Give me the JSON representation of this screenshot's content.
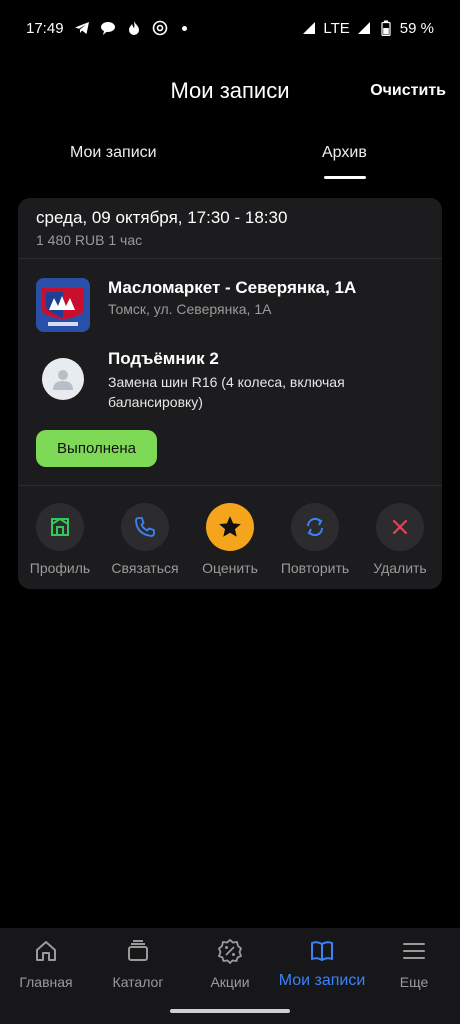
{
  "status_bar": {
    "time": "17:49",
    "network": "LTE",
    "battery": "59 %",
    "icons": [
      "telegram-icon",
      "chat-icon",
      "flame-icon",
      "sync-icon",
      "dot-icon",
      "signal-icon",
      "battery-icon"
    ]
  },
  "header": {
    "title": "Мои записи",
    "clear_label": "Очистить"
  },
  "tabs": [
    {
      "label": "Мои записи",
      "active": false
    },
    {
      "label": "Архив",
      "active": true
    }
  ],
  "booking": {
    "datetime": "среда, 09 октября, 17:30 - 18:30",
    "price_duration": "1 480 RUB 1 час",
    "company": {
      "name": "Масломаркет - Северянка, 1А",
      "address": "Томск, ул. Северянка, 1А"
    },
    "service": {
      "resource": "Подъёмник 2",
      "description": "Замена шин R16 (4 колеса, включая балансировку)"
    },
    "status": "Выполнена",
    "actions": [
      {
        "label": "Профиль",
        "icon": "store-icon",
        "color": "#34c759"
      },
      {
        "label": "Связаться",
        "icon": "phone-icon",
        "color": "#3b82f6"
      },
      {
        "label": "Оценить",
        "icon": "star-icon",
        "color": "#f5a51c"
      },
      {
        "label": "Повторить",
        "icon": "repeat-icon",
        "color": "#3b82f6"
      },
      {
        "label": "Удалить",
        "icon": "close-icon",
        "color": "#e83e5a"
      }
    ]
  },
  "bottom_nav": [
    {
      "label": "Главная",
      "icon": "home-icon",
      "active": false
    },
    {
      "label": "Каталог",
      "icon": "catalog-icon",
      "active": false
    },
    {
      "label": "Акции",
      "icon": "percent-icon",
      "active": false
    },
    {
      "label": "Мои записи",
      "icon": "book-icon",
      "active": true
    },
    {
      "label": "Еще",
      "icon": "menu-icon",
      "active": false
    }
  ],
  "colors": {
    "background": "#000000",
    "card": "#1c1c1e",
    "accent": "#3b82f6",
    "success": "#7ed957",
    "rating": "#f5a51c",
    "danger": "#e83e5a"
  }
}
